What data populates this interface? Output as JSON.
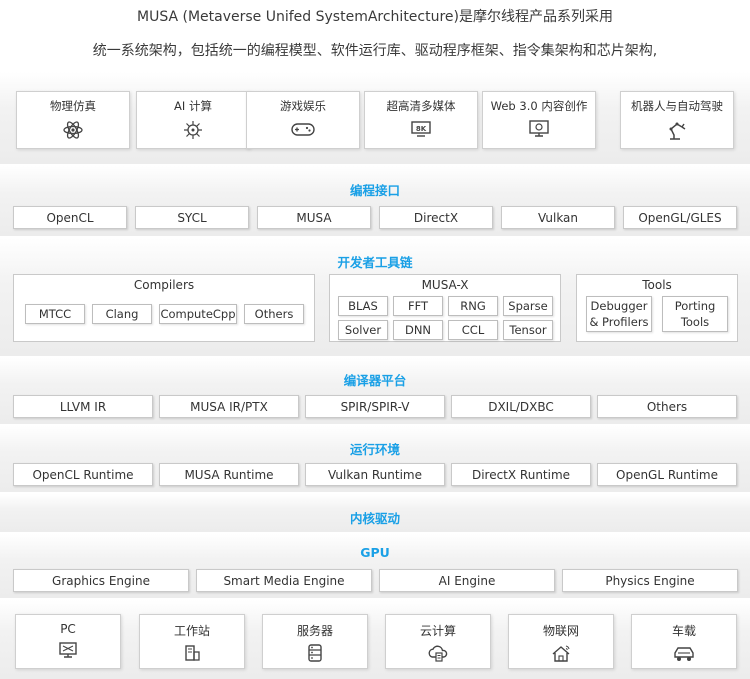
{
  "header": {
    "line1": "MUSA (Metaverse Unifed SystemArchitecture)是摩尔线程产品系列采用",
    "line2": "统一系统架构，包括统一的编程模型、软件运行库、驱动程序框架、指令集架构和芯片架构,"
  },
  "apps": [
    {
      "label": "物理仿真",
      "icon": "atom-icon"
    },
    {
      "label": "AI 计算",
      "icon": "ai-chip-icon"
    },
    {
      "label": "游戏娱乐",
      "icon": "gamepad-icon"
    },
    {
      "label": "超高清多媒体",
      "icon": "8k-display-icon"
    },
    {
      "label": "Web 3.0 内容创作",
      "icon": "content-creation-icon"
    },
    {
      "label": "机器人与自动驾驶",
      "icon": "robot-arm-icon"
    }
  ],
  "programming": {
    "title": "编程接口",
    "items": [
      "OpenCL",
      "SYCL",
      "MUSA",
      "DirectX",
      "Vulkan",
      "OpenGL/GLES"
    ]
  },
  "toolchain": {
    "title": "开发者工具链",
    "compilers": {
      "title": "Compilers",
      "items": [
        "MTCC",
        "Clang",
        "ComputeCpp",
        "Others"
      ]
    },
    "musax": {
      "title": "MUSA-X",
      "items": [
        "BLAS",
        "FFT",
        "RNG",
        "Sparse",
        "Solver",
        "DNN",
        "CCL",
        "Tensor"
      ]
    },
    "tools": {
      "title": "Tools",
      "items": [
        "Debugger & Profilers",
        "Porting Tools"
      ]
    }
  },
  "compiler_platform": {
    "title": "编译器平台",
    "items": [
      "LLVM IR",
      "MUSA IR/PTX",
      "SPIR/SPIR-V",
      "DXIL/DXBC",
      "Others"
    ]
  },
  "runtime": {
    "title": "运行环境",
    "items": [
      "OpenCL Runtime",
      "MUSA Runtime",
      "Vulkan Runtime",
      "DirectX Runtime",
      "OpenGL Runtime"
    ]
  },
  "kernel_driver": {
    "title": "内核驱动"
  },
  "gpu": {
    "title": "GPU",
    "items": [
      "Graphics Engine",
      "Smart Media Engine",
      "AI Engine",
      "Physics Engine"
    ]
  },
  "devices": [
    {
      "label": "PC",
      "icon": "pc-icon"
    },
    {
      "label": "工作站",
      "icon": "workstation-icon"
    },
    {
      "label": "服务器",
      "icon": "server-icon"
    },
    {
      "label": "云计算",
      "icon": "cloud-computing-icon"
    },
    {
      "label": "物联网",
      "icon": "iot-icon"
    },
    {
      "label": "车载",
      "icon": "car-icon"
    }
  ],
  "colors": {
    "accent": "#1aa0e6",
    "icon": "#444444"
  }
}
